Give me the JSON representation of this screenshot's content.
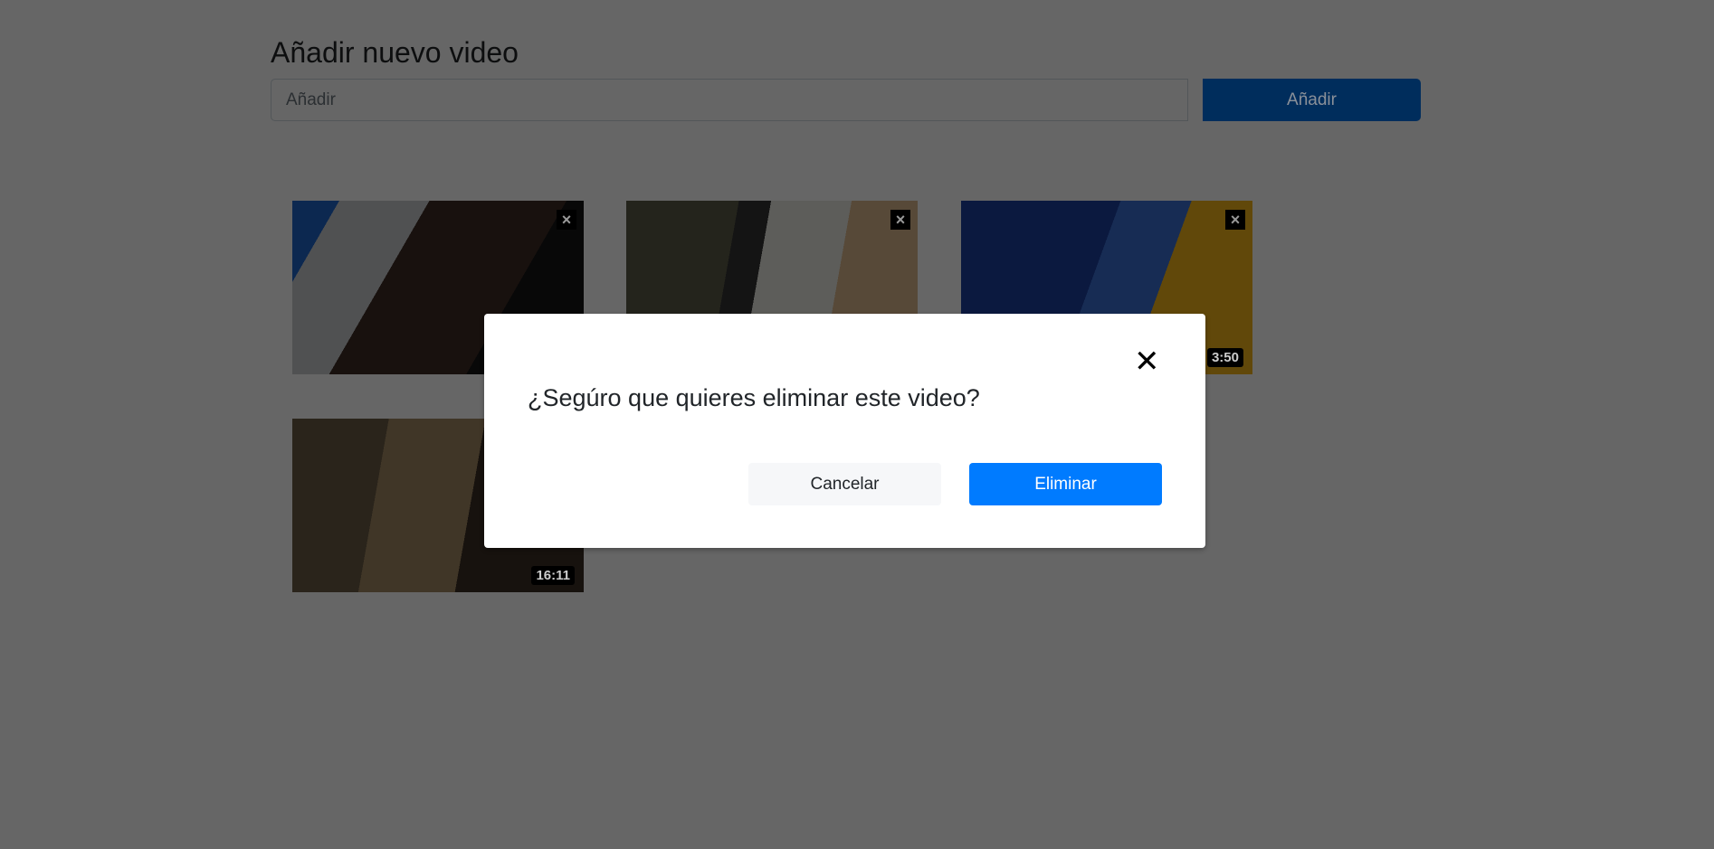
{
  "header": {
    "title": "Añadir nuevo video"
  },
  "add_form": {
    "placeholder": "Añadir",
    "button_label": "Añadir"
  },
  "videos": [
    {
      "duration": "",
      "close": "×"
    },
    {
      "duration": "",
      "close": "×"
    },
    {
      "duration": "3:50",
      "close": "×"
    },
    {
      "duration": "16:11",
      "close": "×"
    }
  ],
  "modal": {
    "close": "✕",
    "message": "¿Segúro que quieres eliminar este video?",
    "cancel_label": "Cancelar",
    "confirm_label": "Eliminar"
  }
}
